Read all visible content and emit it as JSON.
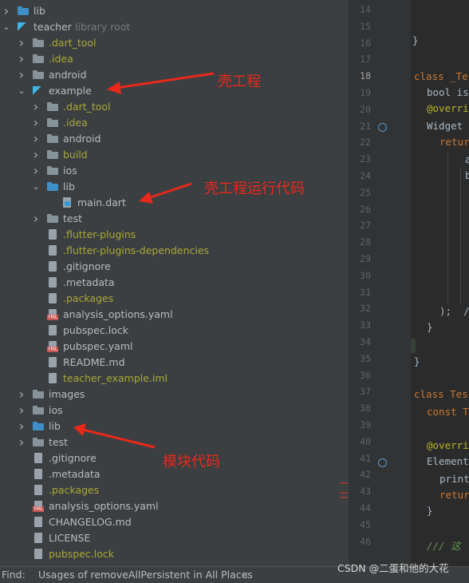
{
  "project_tree": {
    "rows": [
      {
        "label": "lib",
        "color": "#bbbbbb",
        "icon": "folder-blue-icon"
      },
      {
        "label": "teacher",
        "suffix": "library root",
        "color": "#bbbbbb",
        "icon": "flutter-icon"
      },
      {
        "label": ".dart_tool",
        "color": "#a8a836",
        "icon": "folder-icon"
      },
      {
        "label": ".idea",
        "color": "#a8a836",
        "icon": "folder-gear-icon"
      },
      {
        "label": "android",
        "color": "#bbbbbb",
        "icon": "folder-icon"
      },
      {
        "label": "example",
        "color": "#bbbbbb",
        "icon": "flutter-icon"
      },
      {
        "label": ".dart_tool",
        "color": "#a8a836",
        "icon": "folder-icon"
      },
      {
        "label": ".idea",
        "color": "#a8a836",
        "icon": "folder-gear-icon"
      },
      {
        "label": "android",
        "color": "#bbbbbb",
        "icon": "folder-icon"
      },
      {
        "label": "build",
        "color": "#a8a836",
        "icon": "folder-gear-icon"
      },
      {
        "label": "ios",
        "color": "#bbbbbb",
        "icon": "folder-icon"
      },
      {
        "label": "lib",
        "color": "#bbbbbb",
        "icon": "folder-blue-icon"
      },
      {
        "label": "main.dart",
        "color": "#bbbbbb",
        "icon": "dart-file-icon"
      },
      {
        "label": "test",
        "color": "#bbbbbb",
        "icon": "folder-test-icon"
      },
      {
        "label": ".flutter-plugins",
        "color": "#a8a836",
        "icon": "file-icon"
      },
      {
        "label": ".flutter-plugins-dependencies",
        "color": "#a8a836",
        "icon": "file-icon"
      },
      {
        "label": ".gitignore",
        "color": "#bbbbbb",
        "icon": "gitignore-file-icon"
      },
      {
        "label": ".metadata",
        "color": "#bbbbbb",
        "icon": "file-icon"
      },
      {
        "label": ".packages",
        "color": "#a8a836",
        "icon": "file-icon"
      },
      {
        "label": "analysis_options.yaml",
        "color": "#bbbbbb",
        "icon": "yaml-file-icon"
      },
      {
        "label": "pubspec.lock",
        "color": "#bbbbbb",
        "icon": "file-icon"
      },
      {
        "label": "pubspec.yaml",
        "color": "#bbbbbb",
        "icon": "yaml-file-icon"
      },
      {
        "label": "README.md",
        "color": "#bbbbbb",
        "icon": "markdown-file-icon"
      },
      {
        "label": "teacher_example.iml",
        "color": "#a8a836",
        "icon": "iml-file-icon"
      },
      {
        "label": "images",
        "color": "#bbbbbb",
        "icon": "folder-icon"
      },
      {
        "label": "ios",
        "color": "#bbbbbb",
        "icon": "folder-icon"
      },
      {
        "label": "lib",
        "color": "#bbbbbb",
        "icon": "folder-blue-icon"
      },
      {
        "label": "test",
        "color": "#bbbbbb",
        "icon": "folder-test-icon"
      },
      {
        "label": ".gitignore",
        "color": "#bbbbbb",
        "icon": "gitignore-file-icon"
      },
      {
        "label": ".metadata",
        "color": "#bbbbbb",
        "icon": "file-icon"
      },
      {
        "label": ".packages",
        "color": "#a8a836",
        "icon": "file-icon"
      },
      {
        "label": "analysis_options.yaml",
        "color": "#bbbbbb",
        "icon": "yaml-file-icon"
      },
      {
        "label": "CHANGELOG.md",
        "color": "#bbbbbb",
        "icon": "markdown-file-icon"
      },
      {
        "label": "LICENSE",
        "color": "#bbbbbb",
        "icon": "file-icon"
      },
      {
        "label": "pubspec.lock",
        "color": "#a8a836",
        "icon": "file-icon"
      }
    ]
  },
  "annotations": {
    "shell_project": "壳工程",
    "shell_run_code": "壳工程运行代码",
    "module_code": "模块代码"
  },
  "editor": {
    "line_numbers": [
      "14",
      "15",
      "16",
      "17",
      "18",
      "19",
      "20",
      "21",
      "22",
      "23",
      "24",
      "25",
      "26",
      "27",
      "28",
      "29",
      "30",
      "31",
      "32",
      "33",
      "34",
      "35",
      "36",
      "37",
      "38",
      "39",
      "40",
      "41",
      "42",
      "43",
      "44",
      "45",
      "46"
    ],
    "lines": {
      "l17": "}",
      "l18": "class _Te",
      "l19": "bool is",
      "l20": "@overri",
      "l21": "Widget ",
      "l22": "retur",
      "l23": "a",
      "l24": "b",
      "l32": ");  /",
      "l33": "}",
      "l36": "}",
      "l37": "class Tes",
      "l38": "const T",
      "l40": "@overri",
      "l41": "Element",
      "l42": "print",
      "l43": "retur",
      "l44": "}",
      "l46": "/// 这"
    }
  },
  "status_bar": {
    "find_label": "Find:",
    "find_tab": "Usages of removeAllPersistent in All Places",
    "close_glyph": "×"
  },
  "watermark": "CSDN @二蛋和他的大花"
}
